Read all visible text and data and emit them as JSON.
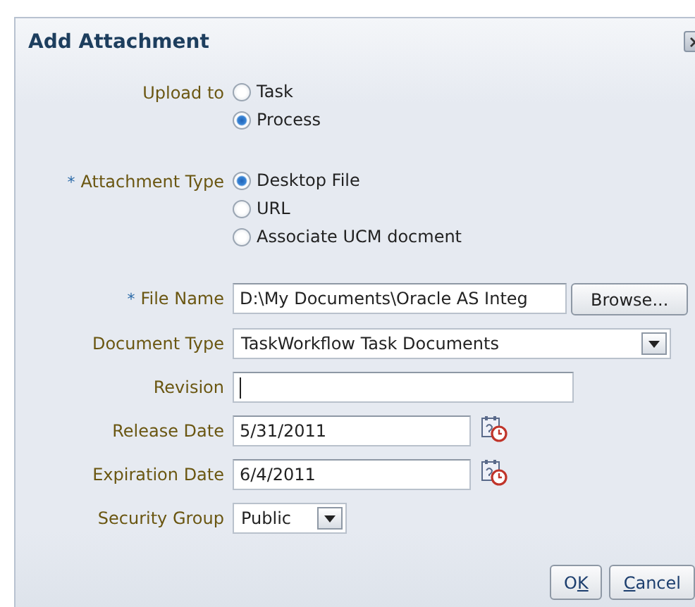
{
  "dialog": {
    "title": "Add Attachment"
  },
  "fields": [
    {
      "kind": "radio",
      "label": "Upload to",
      "options": [
        {
          "label": "Task",
          "selected": false
        },
        {
          "label": "Process",
          "selected": true
        }
      ]
    },
    {
      "kind": "radio",
      "label": "Attachment Type",
      "required_mark": "*",
      "options": [
        {
          "label": "Desktop File",
          "selected": true
        },
        {
          "label": "URL",
          "selected": false
        },
        {
          "label": "Associate UCM docment",
          "selected": false
        }
      ]
    },
    {
      "kind": "file",
      "label": "File Name",
      "required_mark": "*",
      "value": "D:\\My Documents\\Oracle AS Integ",
      "button": "Browse..."
    },
    {
      "kind": "select",
      "label": "Document Type",
      "value": "TaskWorkflow Task Documents"
    },
    {
      "kind": "text",
      "label": "Revision",
      "focused": true
    },
    {
      "kind": "date",
      "label": "Release Date",
      "value": "5/31/2011"
    },
    {
      "kind": "date",
      "label": "Expiration Date",
      "value": "6/4/2011"
    },
    {
      "kind": "combo",
      "label": "Security Group",
      "value": "Public"
    }
  ],
  "buttons": [
    {
      "parts": [
        {
          "text": "O",
          "underlined": false
        },
        {
          "text": "K",
          "underlined": true
        }
      ]
    },
    {
      "parts": [
        {
          "text": "C",
          "underlined": true
        },
        {
          "text": "ancel",
          "underlined": false
        }
      ]
    }
  ]
}
